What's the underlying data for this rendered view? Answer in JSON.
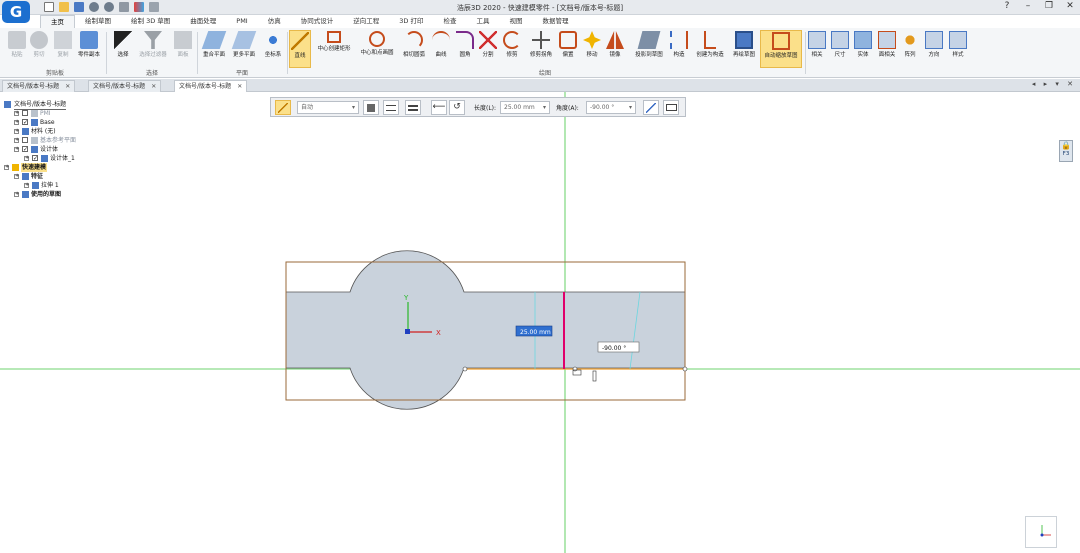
{
  "window": {
    "title": "浩辰3D 2020 - 快速建模零件 - [文档号/版本号-标题]",
    "logo": "G"
  },
  "ribbon_tabs": [
    "主页",
    "绘制草图",
    "绘制 3D 草图",
    "曲面处理",
    "PMI",
    "仿真",
    "协同式设计",
    "逆向工程",
    "3D 打印",
    "检查",
    "工具",
    "视图",
    "数据管理"
  ],
  "ribbon": {
    "clipboard": {
      "label": "剪贴板",
      "buttons": [
        "粘贴",
        "剪切",
        "复制",
        "零件副本"
      ]
    },
    "select": {
      "label": "选择",
      "buttons": [
        "选择",
        "选择过滤器",
        "面板"
      ]
    },
    "plane": {
      "label": "平面",
      "buttons": [
        "重合平面",
        "更多平面",
        "坐标系"
      ]
    },
    "draw": {
      "label": "绘图",
      "buttons": [
        "直线",
        "中心创建矩形",
        "中心和点画圆",
        "相切圆弧",
        "曲线",
        "圆角",
        "分割",
        "修剪",
        "修剪拐角",
        "偏置",
        "移动",
        "镜像",
        "投影到草图",
        "构造",
        "创建为构造",
        "再绘草图",
        "自动缩放草图"
      ]
    },
    "right": {
      "buttons": [
        "相关",
        "尺寸",
        "实体",
        "面相关",
        "阵列",
        "方向",
        "样式"
      ]
    }
  },
  "doc_tabs": [
    {
      "label": "文档号/版本号-标题",
      "active": false
    },
    {
      "label": "文档号/版本号-标题",
      "active": false
    },
    {
      "label": "文档号/版本号-标题",
      "active": true
    }
  ],
  "doc_tabs_right": "◂ ▸ ▾ ✕",
  "tree": {
    "root": "文档号/版本号-标题",
    "items": [
      {
        "label": "PMI",
        "level": 1,
        "checkbox": true,
        "checked": false,
        "dim": true
      },
      {
        "label": "Base",
        "level": 1,
        "checkbox": true,
        "checked": true,
        "dim": false
      },
      {
        "label": "材料 (无)",
        "level": 1,
        "checkbox": false,
        "checked": false,
        "dim": false
      },
      {
        "label": "基本参考平面",
        "level": 1,
        "checkbox": true,
        "checked": false,
        "dim": true
      },
      {
        "label": "设计体",
        "level": 1,
        "checkbox": true,
        "checked": true,
        "dim": false
      },
      {
        "label": "设计体_1",
        "level": 2,
        "checkbox": true,
        "checked": true,
        "dim": false
      },
      {
        "label": "快速建模",
        "level": 0,
        "checkbox": false,
        "checked": false,
        "dim": false,
        "highlight": true
      },
      {
        "label": "特征",
        "level": 1,
        "checkbox": false,
        "checked": false,
        "dim": false,
        "bold": true
      },
      {
        "label": "拉伸 1",
        "level": 2,
        "checkbox": false,
        "checked": false,
        "dim": false
      },
      {
        "label": "使用的草图",
        "level": 1,
        "checkbox": false,
        "checked": false,
        "dim": false,
        "bold": true
      }
    ]
  },
  "sketch_bar": {
    "mode_value": "自动",
    "length_label": "长度(L):",
    "length_value": "25.00 mm",
    "angle_label": "角度(A):",
    "angle_value": "-90.00 °"
  },
  "canvas": {
    "length_dim": "25.00 mm",
    "angle_dim": "-90.00 °",
    "axis_y": "Y",
    "axis_x": "X"
  },
  "lock_label": "F3",
  "colors": {
    "accent": "#1c6fcf",
    "highlight": "#fbe08a",
    "sketch_line": "#e0006a",
    "sketch_fill": "#c9d2dc",
    "frame": "#9a6a3a",
    "green_axis": "#3fc43f"
  }
}
